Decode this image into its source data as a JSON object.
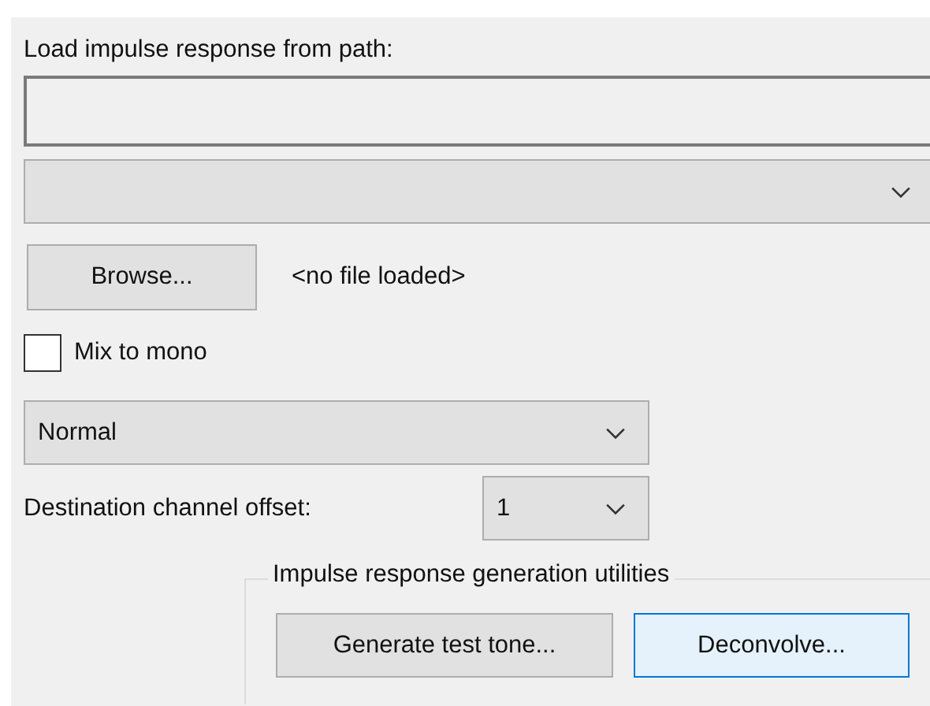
{
  "path_label": "Load impulse response from path:",
  "browse_button": "Browse...",
  "file_status": "<no file loaded>",
  "mix_to_mono": {
    "label": "Mix to mono",
    "checked": false
  },
  "mode_select": {
    "value": "Normal"
  },
  "channel_offset": {
    "label": "Destination channel offset:",
    "value": "1"
  },
  "utilities": {
    "title": "Impulse response generation utilities",
    "buttons": [
      {
        "label": "Generate test tone...",
        "focused": false
      },
      {
        "label": "Deconvolve...",
        "focused": true
      }
    ]
  }
}
